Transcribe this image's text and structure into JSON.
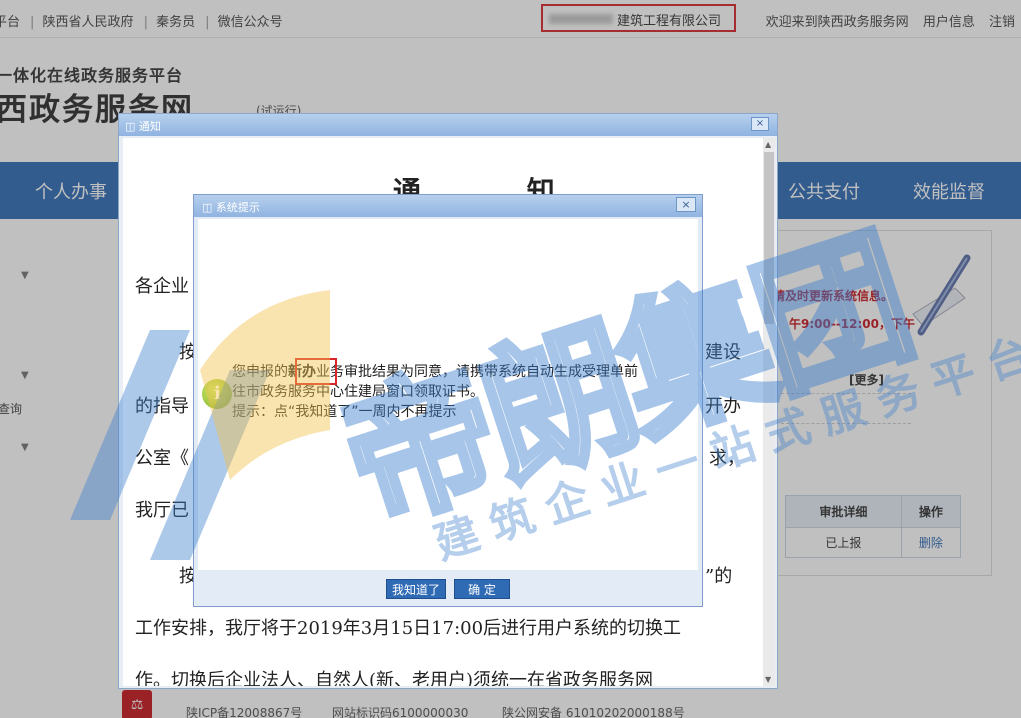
{
  "topbar": {
    "left_items": [
      "平台",
      "陕西省人民政府",
      "秦务员",
      "微信公众号"
    ],
    "company": "建筑工程有限公司",
    "welcome": "欢迎来到陕西政务服务网",
    "user_info": "用户信息",
    "logout": "注销"
  },
  "header": {
    "slogan": "一体化在线政务服务平台",
    "logo": "西政务服务网",
    "trial": "(试运行)"
  },
  "nav": {
    "items": [
      "个人办事",
      "公共支付",
      "效能监督"
    ]
  },
  "sidebar": {
    "label": "查询"
  },
  "right_panel": {
    "notice_red": "请及时更新系统信息。",
    "hours_red": "午9:00--12:00，下午",
    "more": "[更多]",
    "table_headers": [
      "审批详细",
      "操作"
    ],
    "table_row": [
      "已上报",
      "删除"
    ]
  },
  "footer": {
    "icp": "陕ICP备12008867号",
    "site_id": "网站标识码6100000030",
    "police": "陕公网安备 61010202000188号"
  },
  "notice_window": {
    "title": "通知",
    "close": "×",
    "heading": "通  知",
    "lines": [
      "各企业",
      "按",
      "建设",
      "的指导",
      "开办",
      "公室《",
      "求，",
      "我厅已",
      "按",
      "”的",
      "工作安排，我厅将于2019年3月15日17:00后进行用户系统的切换工",
      "作。切换后企业法人、自然人(新、老用户)须统一在省政务服务网"
    ]
  },
  "dialog": {
    "title": "系统提示",
    "close": "×",
    "msg_pre": "您申报的",
    "msg_highlight": "新办",
    "msg_post": "业务审批结果为同意，请携带系统自动生成受理单前",
    "msg_line2": "往市政务服务中心住建局窗口领取证书。",
    "msg_line3": "提示：点“我知道了”一周内不再提示",
    "btn_know": "我知道了",
    "btn_ok": "确 定"
  },
  "watermark": {
    "main": "帝朗集团",
    "sub": "建筑企业一站式服务平台"
  },
  "colors": {
    "nav_blue": "#2f6ab5",
    "highlight_red": "#d9262b",
    "watermark_blue": "#3c7fcf"
  }
}
